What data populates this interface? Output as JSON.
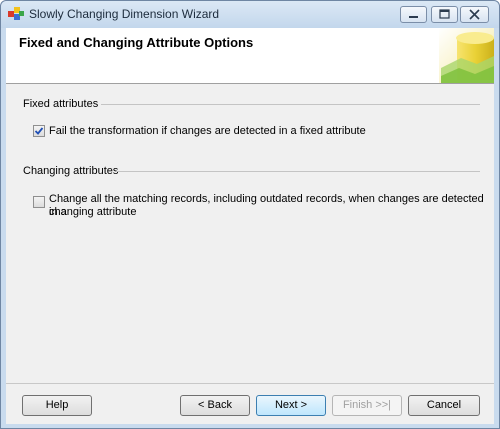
{
  "window": {
    "title": "Slowly Changing Dimension Wizard",
    "icon": "app-icon",
    "controls": [
      "minimize-icon",
      "maximize-icon",
      "close-icon"
    ]
  },
  "header": {
    "title": "Fixed and Changing Attribute Options"
  },
  "fixed": {
    "group_label": "Fixed attributes",
    "checkbox_label": "Fail the transformation if changes are detected in a fixed attribute",
    "checked": true
  },
  "changing": {
    "group_label": "Changing attributes",
    "checkbox_label_line1": "Change all the matching records, including outdated records, when changes are detected in a",
    "checkbox_label_line2": "changing attribute",
    "checked": false
  },
  "buttons": {
    "help": "Help",
    "back": "< Back",
    "next": "Next >",
    "finish": "Finish >>|",
    "cancel": "Cancel"
  },
  "colors": {
    "title_bar": "#c9dbee",
    "client_bg": "#f0f0f0",
    "banner_accent": "#e9d23a"
  }
}
